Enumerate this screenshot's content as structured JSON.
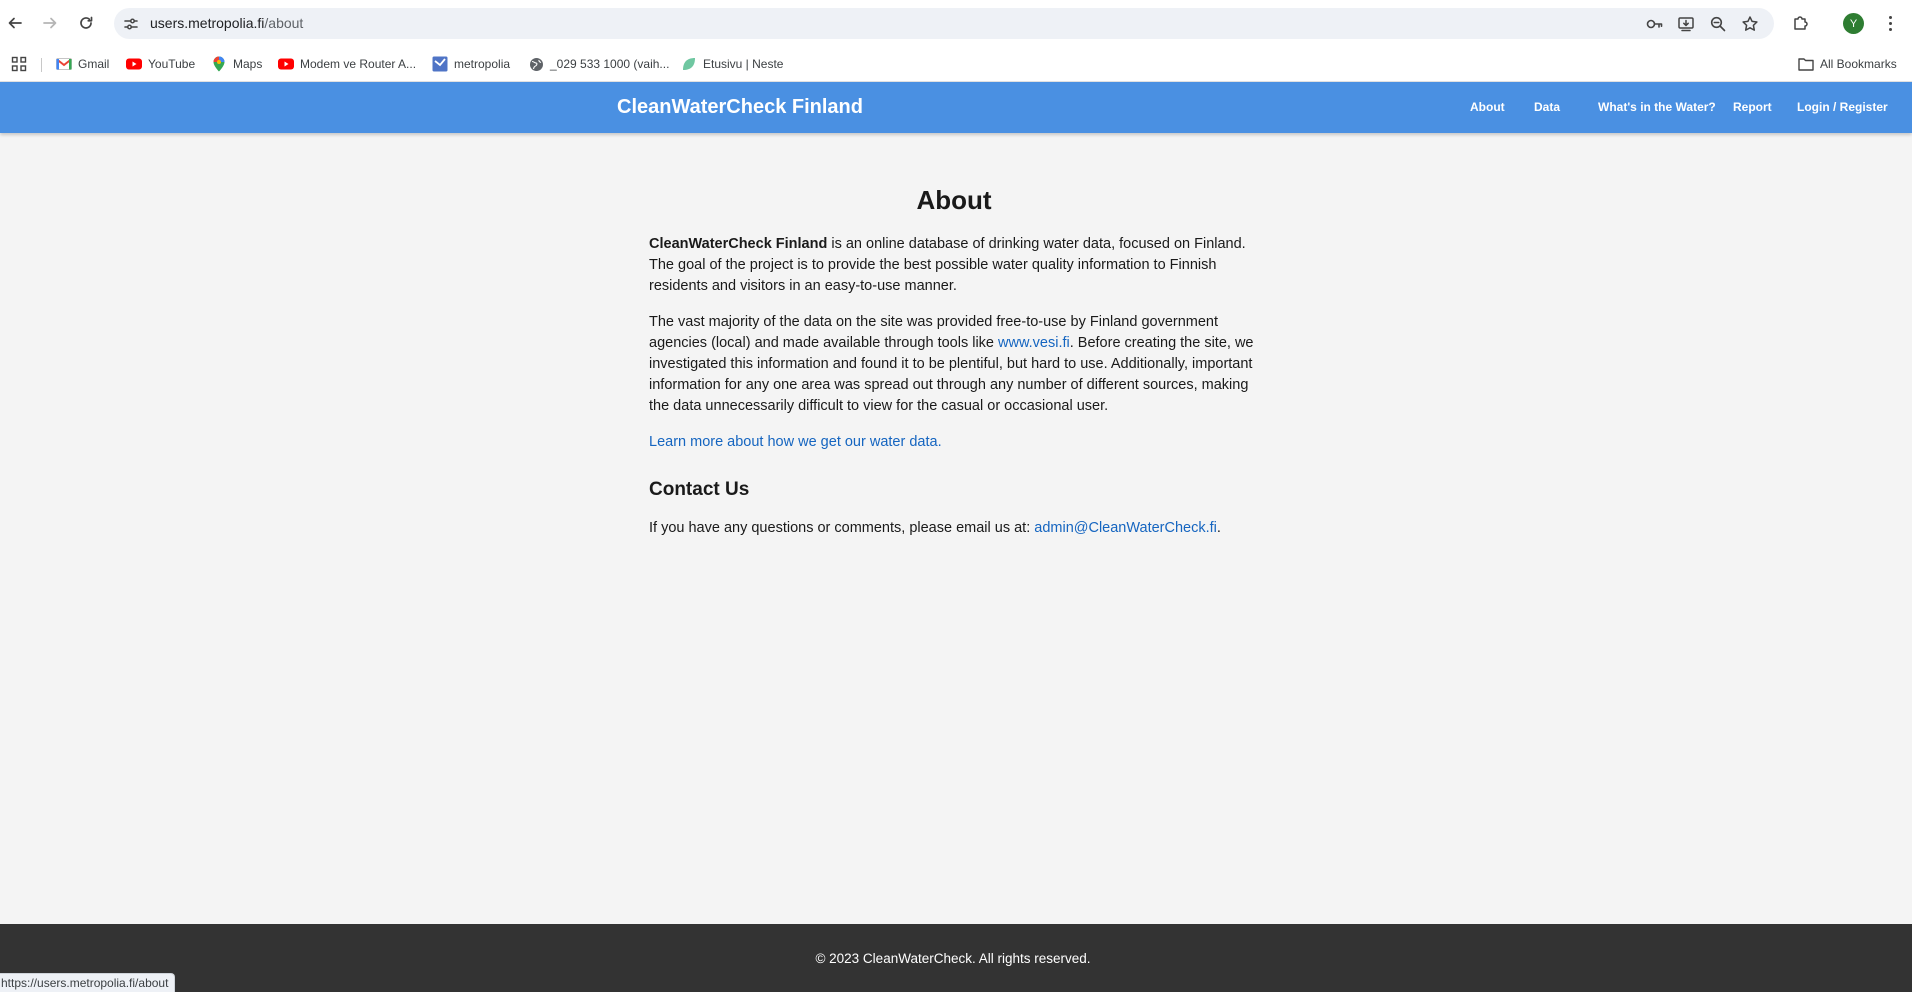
{
  "browser": {
    "url_host": "users.metropolia.fi",
    "url_path": "/about",
    "avatar_letter": "Y",
    "status_url": "https://users.metropolia.fi/about",
    "icons": [
      "back-icon",
      "forward-icon",
      "reload-icon",
      "site-settings-icon",
      "password-key-icon",
      "install-app-icon",
      "zoom-icon",
      "bookmark-star-icon",
      "extensions-icon",
      "menu-icon"
    ]
  },
  "bookmarks": {
    "items": [
      {
        "label": "Gmail",
        "icon": "gmail-icon"
      },
      {
        "label": "YouTube",
        "icon": "youtube-icon"
      },
      {
        "label": "Maps",
        "icon": "maps-icon"
      },
      {
        "label": "Modem ve Router A...",
        "icon": "youtube-icon"
      },
      {
        "label": "metropolia",
        "icon": "metropolia-icon"
      },
      {
        "label": "_029 533 1000 (vaih...",
        "icon": "globe-icon"
      },
      {
        "label": "Etusivu | Neste",
        "icon": "neste-icon"
      }
    ],
    "all_bookmarks": "All Bookmarks"
  },
  "site": {
    "brand": "CleanWaterCheck Finland",
    "nav": [
      "About",
      "Data",
      "What's in the Water?",
      "Report",
      "Login / Register"
    ],
    "accent_color": "#4a90e2"
  },
  "about": {
    "title": "About",
    "p1_strong": "CleanWaterCheck Finland",
    "p1_rest": " is an online database of drinking water data, focused on Finland. The goal of the project is to provide the best possible water quality information to Finnish residents and visitors in an easy-to-use manner.",
    "p2_before": "The vast majority of the data on the site was provided free-to-use by Finland government agencies (local) and made available through tools like ",
    "p2_link": "www.vesi.fi",
    "p2_after": ". Before creating the site, we investigated this information and found it to be plentiful, but hard to use. Additionally, important information for any one area was spread out through any number of different sources, making the data unnecessarily difficult to view for the casual or occasional user.",
    "learn_more": "Learn more about how we get our water data."
  },
  "contact": {
    "title": "Contact Us",
    "text": "If you have any questions or comments, please email us at: ",
    "email": "admin@CleanWaterCheck.fi",
    "after": "."
  },
  "footer": {
    "copyright": "© 2023 CleanWaterCheck. All rights reserved."
  }
}
